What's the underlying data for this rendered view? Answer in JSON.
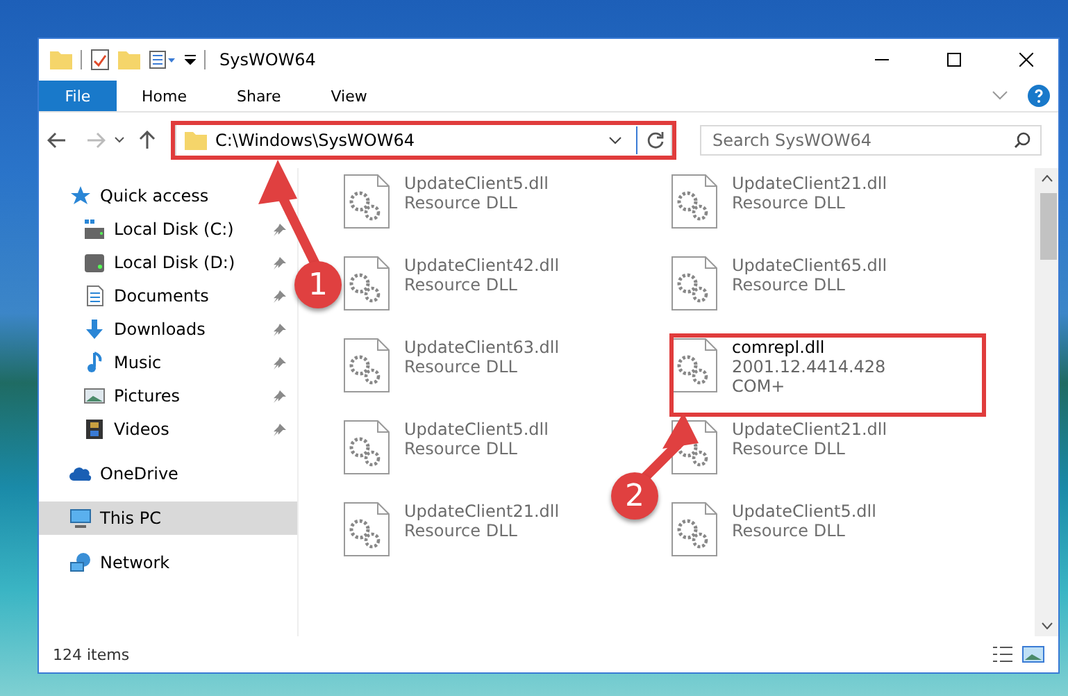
{
  "window": {
    "title": "SysWOW64"
  },
  "ribbon": {
    "tabs": [
      {
        "label": "File",
        "selected": true
      },
      {
        "label": "Home",
        "selected": false
      },
      {
        "label": "Share",
        "selected": false
      },
      {
        "label": "View",
        "selected": false
      }
    ]
  },
  "address": {
    "path": "C:\\Windows\\SysWOW64"
  },
  "search": {
    "placeholder": "Search SysWOW64"
  },
  "nav": [
    {
      "label": "Quick access",
      "selected": false,
      "children": [
        {
          "label": "Local Disk (C:)",
          "pinned": true,
          "selected": false
        },
        {
          "label": "Local Disk (D:)",
          "pinned": true,
          "selected": false
        },
        {
          "label": "Documents",
          "pinned": true,
          "selected": false
        },
        {
          "label": "Downloads",
          "pinned": true,
          "selected": false
        },
        {
          "label": "Music",
          "pinned": true,
          "selected": false
        },
        {
          "label": "Pictures",
          "pinned": true,
          "selected": false
        },
        {
          "label": "Videos",
          "pinned": true,
          "selected": false
        }
      ]
    },
    {
      "label": "OneDrive",
      "selected": false
    },
    {
      "label": "This PC",
      "selected": true
    },
    {
      "label": "Network",
      "selected": false
    }
  ],
  "files": [
    {
      "name": "UpdateClient5.dll",
      "type": "Resource DLL",
      "dimmed": true
    },
    {
      "name": "UpdateClient21.dll",
      "type": "Resource DLL",
      "dimmed": true
    },
    {
      "name": "UpdateClient42.dll",
      "type": "Resource DLL",
      "dimmed": true
    },
    {
      "name": "UpdateClient65.dll",
      "type": "Resource DLL",
      "dimmed": true
    },
    {
      "name": "UpdateClient63.dll",
      "type": "Resource DLL",
      "dimmed": true
    },
    {
      "name": "comrepl.dll",
      "version": "2001.12.4414.428",
      "type": "COM+",
      "dimmed": false
    },
    {
      "name": "UpdateClient5.dll",
      "type": "Resource DLL",
      "dimmed": true
    },
    {
      "name": "UpdateClient21.dll",
      "type": "Resource DLL",
      "dimmed": true
    },
    {
      "name": "UpdateClient21.dll",
      "type": "Resource DLL",
      "dimmed": true
    },
    {
      "name": "UpdateClient5.dll",
      "type": "Resource DLL",
      "dimmed": true
    }
  ],
  "status_bar": {
    "count": "124 items"
  },
  "annotations": [
    {
      "label": "1"
    },
    {
      "label": "2"
    }
  ]
}
